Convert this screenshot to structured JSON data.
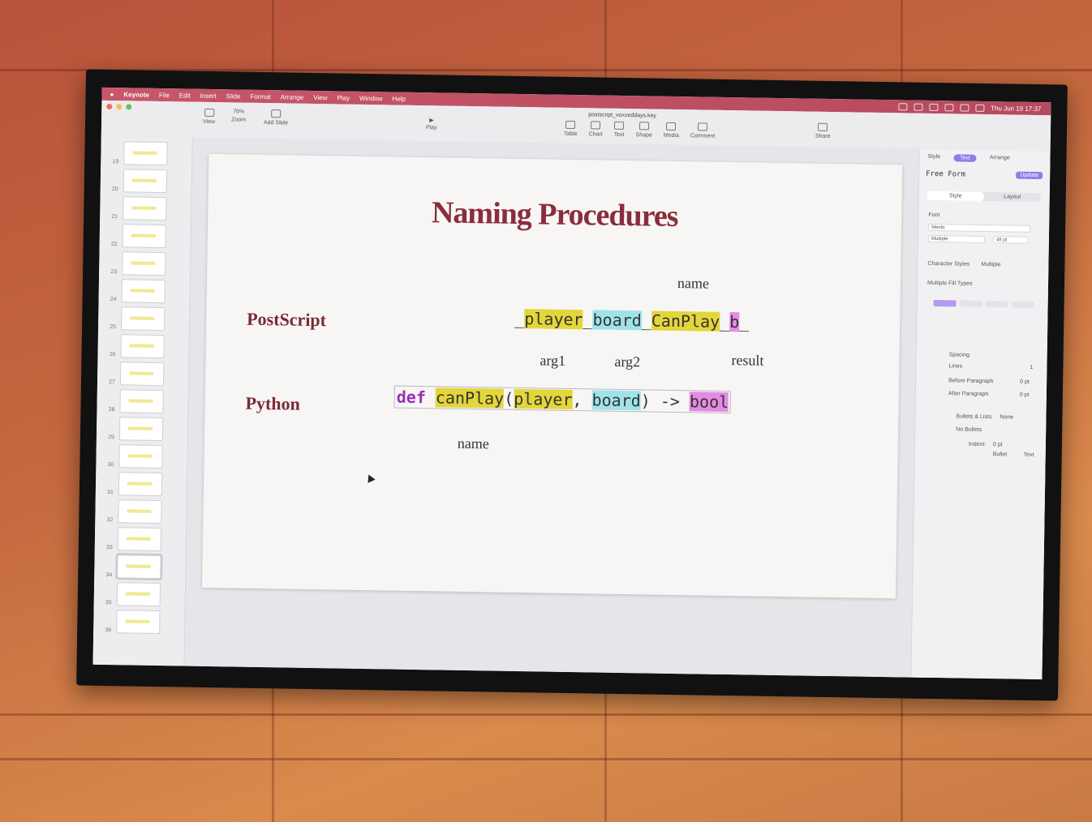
{
  "menubar": {
    "apple_icon": "apple-icon",
    "app_name": "Keynote",
    "items": [
      "File",
      "Edit",
      "Insert",
      "Slide",
      "Format",
      "Arrange",
      "View",
      "Play",
      "Window",
      "Help"
    ],
    "clock": "Thu Jun 19  17:37"
  },
  "toolbar": {
    "document_title": "postscript_voxxeddays.key",
    "view_label": "View",
    "zoom_value": "76%",
    "zoom_label": "Zoom",
    "add_slide_label": "Add Slide",
    "play_label": "Play",
    "insert_items": [
      "Table",
      "Chart",
      "Text",
      "Shape",
      "Media",
      "Comment"
    ],
    "share_label": "Share"
  },
  "navigator": {
    "slide_numbers": [
      "19",
      "20",
      "21",
      "22",
      "23",
      "24",
      "25",
      "26",
      "27",
      "28",
      "29",
      "30",
      "31",
      "32",
      "33",
      "34",
      "35",
      "36"
    ],
    "selected": "34"
  },
  "slide": {
    "title": "Naming Procedures",
    "postscript_label": "PostScript",
    "python_label": "Python",
    "annot_name_top": "name",
    "annot_arg1": "arg1",
    "annot_arg2": "arg2",
    "annot_result": "result",
    "annot_name_bottom": "name",
    "ps_code": {
      "p0": "_",
      "player": "player",
      "p1": "_",
      "board": "board",
      "p2": "_",
      "canplay": "CanPlay",
      "p3": "_",
      "b": "b",
      "p4": "_"
    },
    "py_code": {
      "def": "def",
      "space": " ",
      "canplay": "canPlay",
      "open": "(",
      "player": "player",
      "comma": ", ",
      "board": "board",
      "arrow": ") -> ",
      "bool": "bool"
    }
  },
  "inspector": {
    "tabs": [
      "Style",
      "Text",
      "Arrange"
    ],
    "active_tab": "Text",
    "paragraph_style": "Free Form",
    "update_button": "Update",
    "segment": [
      "Style",
      "Layout"
    ],
    "font_section": "Font",
    "font_name": "Menlo",
    "font_style": "Multiple",
    "font_size": "48 pt",
    "character_styles_label": "Character Styles",
    "character_styles_value": "Multiple",
    "fill_types": "Multiple Fill Types",
    "spacing_label": "Spacing",
    "lines_label": "Lines",
    "lines_value": "1",
    "before_paragraph": "Before Paragraph",
    "before_value": "0 pt",
    "after_paragraph": "After Paragraph",
    "after_value": "0 pt",
    "bullets_label": "Bullets & Lists",
    "bullets_value": "None",
    "no_bullets": "No Bullets",
    "indent_label": "Indent:",
    "indent_bullet": "Bullet",
    "indent_text": "Text",
    "indent_value": "0 pt"
  },
  "colors": {
    "title": "#8a2d3b",
    "highlight_yellow": "#e3d63a",
    "highlight_blue": "#9fe3ea",
    "highlight_pink": "#e58be4",
    "keyword": "#9b2db8",
    "accent": "#8f7bea",
    "menubar": "#c8566a"
  }
}
